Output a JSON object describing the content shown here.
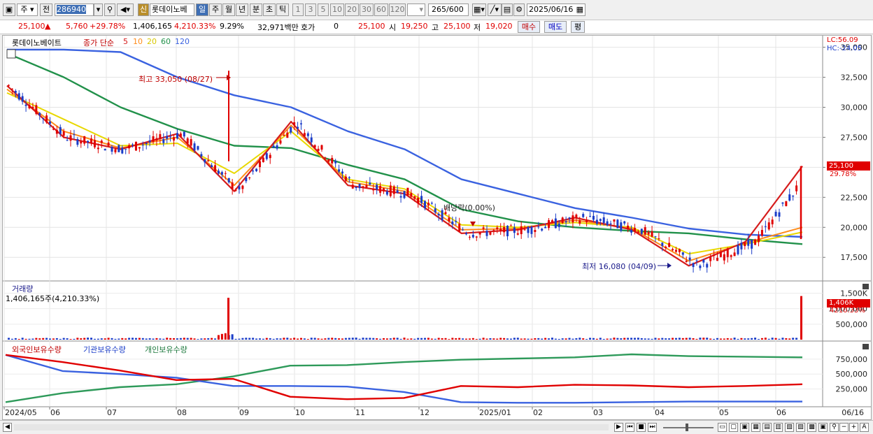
{
  "toolbar": {
    "type1": "주",
    "type2": "전",
    "code": "286940",
    "stock_name": "롯데이노베",
    "new_badge": "신",
    "periods": [
      "일",
      "주",
      "월",
      "년",
      "분",
      "초",
      "틱"
    ],
    "minutes": [
      "1",
      "3",
      "5",
      "10",
      "20",
      "30",
      "60",
      "120"
    ],
    "count": "265",
    "count_total": "/600",
    "date": "2025/06/16"
  },
  "quote": {
    "price": "25,100",
    "change": "5,760",
    "change_pct": "+29.78%",
    "volume": "1,406,165",
    "vol_ratio": "4,210.33%",
    "turnover_ratio": "9.29%",
    "amount": "32,971백만",
    "hoga_label": "호가",
    "hoga_value": "0",
    "hoga_price": "25,100",
    "open_label": "시",
    "open": "19,250",
    "high_label": "고",
    "high": "25,100",
    "low_label": "저",
    "low": "19,020",
    "buy_button": "매수",
    "sell_button": "매도",
    "avg_button": "평"
  },
  "price_panel": {
    "stock_name": "롯데이노베이트",
    "ma_label": "종가 단순",
    "ma_periods": [
      "5",
      "10",
      "20",
      "60",
      "120"
    ],
    "lc": "LC:56.09",
    "hc": "HC:-24.05",
    "y_ticks": [
      "35,000",
      "32,500",
      "30,000",
      "27,500",
      "25,000",
      "22,500",
      "20,000",
      "17,500"
    ],
    "current_price": "25,100",
    "current_pct": "29.78%",
    "high_note": "최고 33,050 (08/27)",
    "low_note": "최저 16,080 (04/09)",
    "dividend_note": "배당락(0.00%)"
  },
  "volume_panel": {
    "title": "거래량",
    "value": "1,406,165주(4,210.33%)",
    "y_ticks": [
      "1,500K",
      "1,000,000",
      "500,000"
    ],
    "current": "1,406K",
    "current_pct": "4210.33%"
  },
  "holdings_panel": {
    "series": [
      "외국인보유수량",
      "기관보유수량",
      "개인보유수량"
    ],
    "y_ticks": [
      "750,000",
      "500,000",
      "250,000"
    ]
  },
  "x_axis": {
    "labels": [
      "2024/05",
      "06",
      "07",
      "08",
      "09",
      "10",
      "11",
      "12",
      "2025/01",
      "02",
      "03",
      "04",
      "05",
      "06"
    ],
    "right_label": "06/16"
  },
  "colors": {
    "up": "#e00000",
    "down": "#1a3cc8",
    "ma5": "#d61c1c",
    "ma10": "#ff8c1a",
    "ma20": "#e8d800",
    "ma60": "#21914a",
    "ma120": "#3a62e0",
    "foreign": "#e00000",
    "inst": "#3a62e0",
    "indiv": "#2e9a5a"
  },
  "chart_data": {
    "type": "line",
    "title": "롯데이노베이트",
    "x": [
      "2024/05",
      "06",
      "07",
      "08",
      "09",
      "10",
      "11",
      "12",
      "2025/01",
      "02",
      "03",
      "04",
      "05",
      "06"
    ],
    "ylim": [
      16000,
      35500
    ],
    "series": [
      {
        "name": "5",
        "values": [
          31800,
          27500,
          26500,
          27800,
          23000,
          28800,
          23500,
          22800,
          19500,
          19800,
          20800,
          19800,
          16800,
          18800,
          25100
        ]
      },
      {
        "name": "10",
        "values": [
          31500,
          28000,
          26600,
          27500,
          23500,
          28500,
          23800,
          23000,
          19800,
          19900,
          20600,
          19900,
          17200,
          18700,
          20000
        ]
      },
      {
        "name": "20",
        "values": [
          31200,
          29000,
          26800,
          27000,
          24500,
          28000,
          24000,
          23200,
          20200,
          20000,
          20400,
          20000,
          17800,
          18600,
          19600
        ]
      },
      {
        "name": "60",
        "values": [
          34500,
          32500,
          30000,
          28200,
          26800,
          26600,
          25200,
          24000,
          21500,
          20500,
          20000,
          19700,
          19500,
          19000,
          18600
        ]
      },
      {
        "name": "120",
        "values": [
          34800,
          34800,
          34600,
          32500,
          31000,
          30000,
          28000,
          26500,
          24000,
          22800,
          21600,
          20800,
          19900,
          19400,
          19200
        ]
      }
    ]
  }
}
